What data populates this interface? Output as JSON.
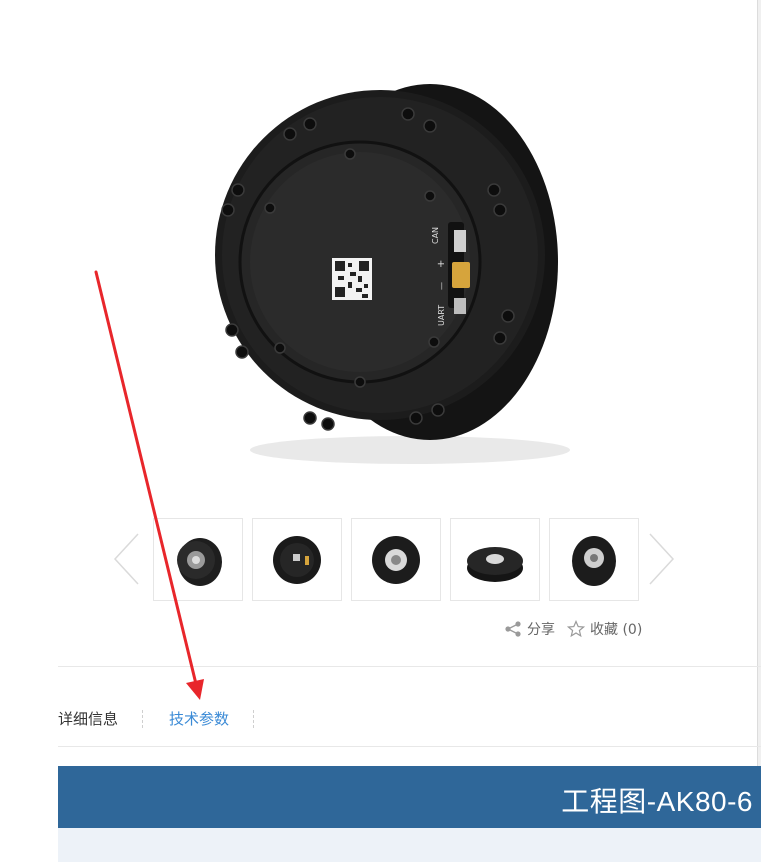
{
  "product": {
    "main_image_alt": "",
    "engraving_left": "UART",
    "engraving_minus": "—",
    "engraving_plus": "+",
    "engraving_right": "CAN"
  },
  "thumbnails": {
    "count": 5,
    "prev_icon": "chevron-left-icon",
    "next_icon": "chevron-right-icon"
  },
  "actions": {
    "share_label": "分享",
    "favorite_label": "收藏 (0)",
    "share_icon": "share-icon",
    "favorite_icon": "star-icon"
  },
  "tabs": [
    {
      "label": "详细信息",
      "active": false
    },
    {
      "label": "技术参数",
      "active": true
    }
  ],
  "banner": {
    "title": "工程图-AK80-6"
  },
  "colors": {
    "accent_link": "#3a8ad6",
    "banner_bg": "#2f6799",
    "annotation_arrow": "#e8262b"
  }
}
